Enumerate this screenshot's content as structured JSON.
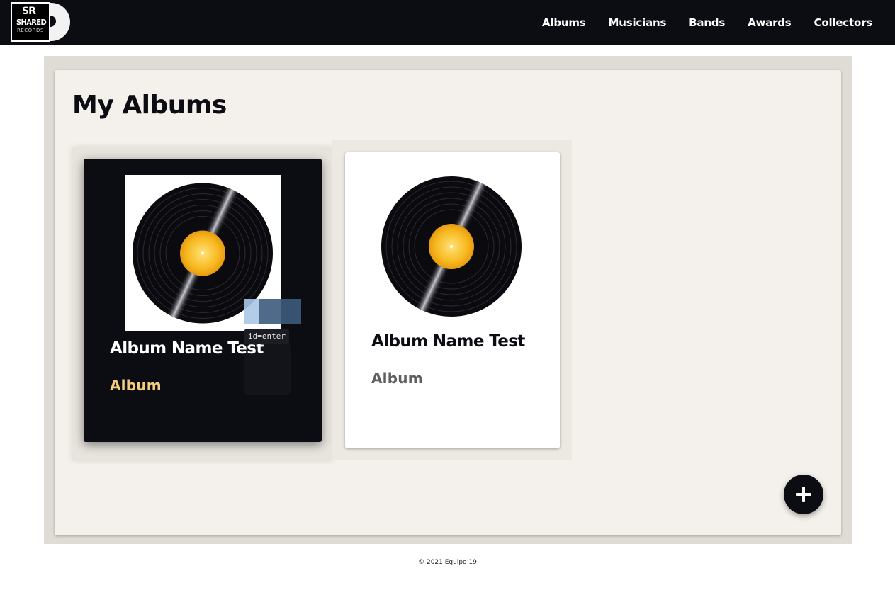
{
  "brand": {
    "logo_sr": "SR",
    "logo_shared": "SHARED",
    "logo_records": "RECORDS"
  },
  "nav": {
    "items": [
      {
        "label": "Albums"
      },
      {
        "label": "Musicians"
      },
      {
        "label": "Bands"
      },
      {
        "label": "Awards"
      },
      {
        "label": "Collectors"
      }
    ]
  },
  "main": {
    "title": "My Albums",
    "albums": [
      {
        "name": "Album Name Test",
        "type": "Album",
        "state": "hovered"
      },
      {
        "name": "Album Name Test",
        "type": "Album",
        "state": "default"
      }
    ]
  },
  "overlay": {
    "tag": "id=enter"
  },
  "fab": {
    "icon": "plus-icon"
  },
  "footer": {
    "text": "© 2021 Equipo 19"
  },
  "colors": {
    "navbar_bg": "#0c0d12",
    "panel_bg": "#f4f0eb",
    "frame_bg": "#dfdbd5",
    "card_active_bg": "#0c0d12",
    "accent_gold": "#f3cd7d",
    "record_label": "#f5b21b"
  }
}
